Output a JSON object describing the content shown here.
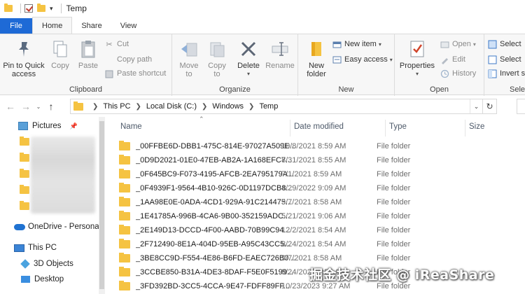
{
  "window": {
    "title": "Temp"
  },
  "ribbon_tabs": [
    {
      "label": "File"
    },
    {
      "label": "Home"
    },
    {
      "label": "Share"
    },
    {
      "label": "View"
    }
  ],
  "clipboard": {
    "pin_label": "Pin to Quick access",
    "copy_label": "Copy",
    "paste_label": "Paste",
    "cut_label": "Cut",
    "copy_path_label": "Copy path",
    "paste_shortcut_label": "Paste shortcut",
    "group_label": "Clipboard"
  },
  "organize": {
    "move_to_label": "Move to",
    "copy_to_label": "Copy to",
    "delete_label": "Delete",
    "rename_label": "Rename",
    "group_label": "Organize"
  },
  "new_group": {
    "new_folder_label": "New folder",
    "new_item_label": "New item",
    "easy_access_label": "Easy access",
    "group_label": "New"
  },
  "open_group": {
    "properties_label": "Properties",
    "open_label": "Open",
    "edit_label": "Edit",
    "history_label": "History",
    "group_label": "Open"
  },
  "select_group": {
    "select_all_label": "Select",
    "select_none_label": "Select",
    "invert_label": "Invert s",
    "group_label": "Sele"
  },
  "address": {
    "crumbs": [
      "This PC",
      "Local Disk (C:)",
      "Windows",
      "Temp"
    ]
  },
  "nav_pane": {
    "pictures": "Pictures",
    "onedrive": "OneDrive - Persona",
    "this_pc": "This PC",
    "objects_3d": "3D Objects",
    "desktop": "Desktop"
  },
  "columns": {
    "name": "Name",
    "date_modified": "Date modified",
    "type": "Type",
    "size": "Size"
  },
  "files": [
    {
      "name": "_00FFBE6D-DBB1-475C-814E-97027A509E...",
      "date": "10/8/2021 8:59 AM",
      "type": "File folder"
    },
    {
      "name": "_0D9D2021-01E0-47EB-AB2A-1A168EFC7...",
      "date": "8/31/2021 8:55 AM",
      "type": "File folder"
    },
    {
      "name": "_0F645BC9-F073-4195-AFCB-2EA795179A...",
      "date": "7/1/2021 8:59 AM",
      "type": "File folder"
    },
    {
      "name": "_0F4939F1-9564-4B10-926C-0D1197DCB8...",
      "date": "4/29/2022 9:09 AM",
      "type": "File folder"
    },
    {
      "name": "_1AA98E0E-0ADA-4CD1-929A-91C214475...",
      "date": "9/7/2021 8:58 AM",
      "type": "File folder"
    },
    {
      "name": "_1E41785A-996B-4CA6-9B00-352159ADC...",
      "date": "5/21/2021 9:06 AM",
      "type": "File folder"
    },
    {
      "name": "_2E149D13-DCCD-4F00-AABD-70B99C94...",
      "date": "12/2/2021 8:54 AM",
      "type": "File folder"
    },
    {
      "name": "_2F712490-8E1A-404D-95EB-A95C43CC5...",
      "date": "8/24/2021 8:54 AM",
      "type": "File folder"
    },
    {
      "name": "_3BE8CC9D-F554-4E86-B6FD-EAEC726B0...",
      "date": "9/7/2021 8:58 AM",
      "type": "File folder"
    },
    {
      "name": "_3CCBE850-B31A-4DE3-8DAF-F5E0F5199...",
      "date": "8/24/2021 8:55 AM",
      "type": "File folder"
    },
    {
      "name": "_3FD392BD-3CC5-4CCA-9E47-FDFF89FF...",
      "date": "10/23/2023 9:27 AM",
      "type": "File folder"
    }
  ],
  "watermark": "掘金技术社区 @ iReaShare"
}
